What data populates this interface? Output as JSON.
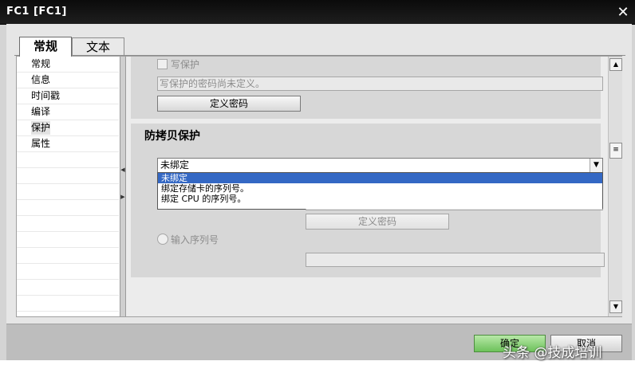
{
  "window": {
    "title": "FC1 [FC1]",
    "close_glyph": "✕"
  },
  "tabs": [
    {
      "label": "常规",
      "active": true
    },
    {
      "label": "文本",
      "active": false
    }
  ],
  "sidebar": {
    "items": [
      {
        "label": "常规",
        "selected": false
      },
      {
        "label": "信息",
        "selected": false
      },
      {
        "label": "时间戳",
        "selected": false
      },
      {
        "label": "编译",
        "selected": false
      },
      {
        "label": "保护",
        "selected": true
      },
      {
        "label": "属性",
        "selected": false
      }
    ]
  },
  "write_protection": {
    "checkbox_label": "写保护",
    "password_status": "写保护的密码尚未定义。",
    "define_password_button": "定义密码"
  },
  "copy_protection": {
    "title": "防拷贝保护",
    "binding_select": {
      "selected": "未绑定",
      "options": [
        "未绑定",
        "绑定存储卡的序列号。",
        "绑定 CPU 的序列号。"
      ],
      "highlighted_index": 0
    },
    "define_password_button": "定义密码",
    "serial_radio_label": "输入序列号"
  },
  "footer": {
    "ok_label": "确定",
    "cancel_label": "取消"
  },
  "watermark": "头条 @技成培训",
  "colors": {
    "title_bar": "#111111",
    "dropdown_highlight": "#3468c4",
    "ok_button": "#6cc25a"
  },
  "icons": {
    "close": "close-icon",
    "scroll_up": "scroll-up-icon",
    "scroll_down": "scroll-down-icon",
    "combo_arrow": "chevron-down-icon",
    "splitter_left": "collapse-left-icon",
    "splitter_right": "expand-right-icon"
  }
}
